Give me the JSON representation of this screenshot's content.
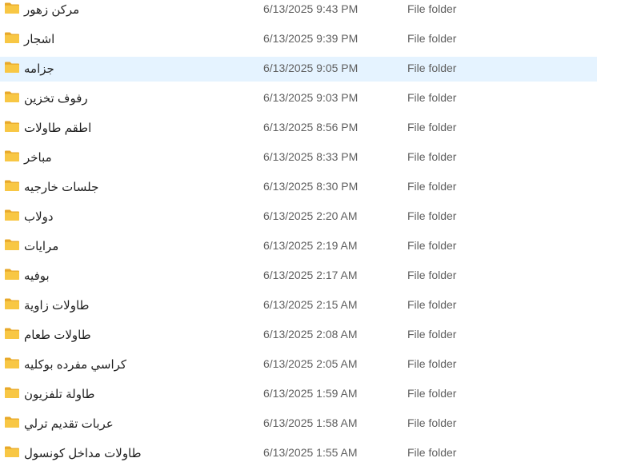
{
  "files": [
    {
      "name": "مركن زهور",
      "date_modified": "6/13/2025 9:43 PM",
      "type": "File folder",
      "selected": false
    },
    {
      "name": "اشجار",
      "date_modified": "6/13/2025 9:39 PM",
      "type": "File folder",
      "selected": false
    },
    {
      "name": "جزامه",
      "date_modified": "6/13/2025 9:05 PM",
      "type": "File folder",
      "selected": true
    },
    {
      "name": "رفوف تخزين",
      "date_modified": "6/13/2025 9:03 PM",
      "type": "File folder",
      "selected": false
    },
    {
      "name": "اطقم طاولات",
      "date_modified": "6/13/2025 8:56 PM",
      "type": "File folder",
      "selected": false
    },
    {
      "name": "مباخر",
      "date_modified": "6/13/2025 8:33 PM",
      "type": "File folder",
      "selected": false
    },
    {
      "name": "جلسات خارجيه",
      "date_modified": "6/13/2025 8:30 PM",
      "type": "File folder",
      "selected": false
    },
    {
      "name": "دولاب",
      "date_modified": "6/13/2025 2:20 AM",
      "type": "File folder",
      "selected": false
    },
    {
      "name": "مرايات",
      "date_modified": "6/13/2025 2:19 AM",
      "type": "File folder",
      "selected": false
    },
    {
      "name": "بوفيه",
      "date_modified": "6/13/2025 2:17 AM",
      "type": "File folder",
      "selected": false
    },
    {
      "name": "طاولات زاوية",
      "date_modified": "6/13/2025 2:15 AM",
      "type": "File folder",
      "selected": false
    },
    {
      "name": "طاولات طعام",
      "date_modified": "6/13/2025 2:08 AM",
      "type": "File folder",
      "selected": false
    },
    {
      "name": "كراسي مفرده بوكليه",
      "date_modified": "6/13/2025 2:05 AM",
      "type": "File folder",
      "selected": false
    },
    {
      "name": "طاولة تلفزيون",
      "date_modified": "6/13/2025 1:59 AM",
      "type": "File folder",
      "selected": false
    },
    {
      "name": "عربات تقديم ترلي",
      "date_modified": "6/13/2025 1:58 AM",
      "type": "File folder",
      "selected": false
    },
    {
      "name": "طاولات مداخل كونسول",
      "date_modified": "6/13/2025 1:55 AM",
      "type": "File folder",
      "selected": false
    }
  ],
  "icons": {
    "folder": "folder-icon",
    "folder_color": "#f8c744"
  },
  "colors": {
    "selection_background": "#e5f3ff"
  }
}
